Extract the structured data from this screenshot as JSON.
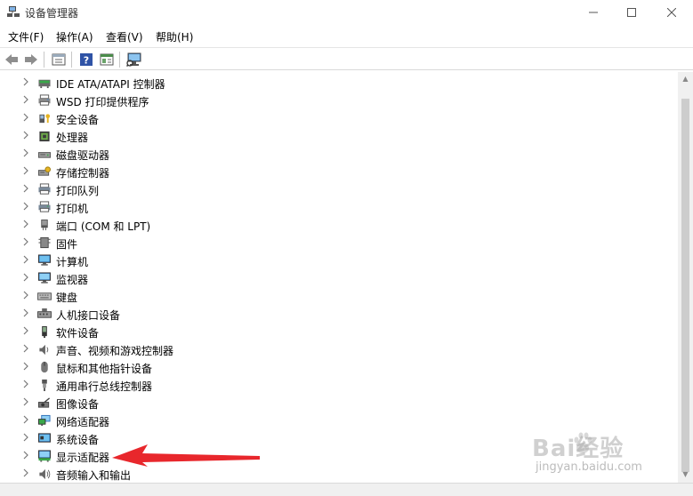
{
  "window": {
    "title": "设备管理器"
  },
  "window_controls": {
    "minimize": "—",
    "maximize": "☐",
    "close": "✕"
  },
  "menu": [
    {
      "label": "文件(F)"
    },
    {
      "label": "操作(A)"
    },
    {
      "label": "查看(V)"
    },
    {
      "label": "帮助(H)"
    }
  ],
  "toolbar": {
    "buttons": [
      "back-icon",
      "forward-icon",
      "properties-icon",
      "help-icon",
      "update-driver-icon",
      "scan-hardware-icon"
    ]
  },
  "tree": {
    "items": [
      {
        "label": "IDE ATA/ATAPI 控制器",
        "icon": "ide-controller-icon"
      },
      {
        "label": "WSD 打印提供程序",
        "icon": "wsd-printer-icon"
      },
      {
        "label": "安全设备",
        "icon": "security-device-icon"
      },
      {
        "label": "处理器",
        "icon": "processor-icon"
      },
      {
        "label": "磁盘驱动器",
        "icon": "disk-drive-icon"
      },
      {
        "label": "存储控制器",
        "icon": "storage-controller-icon"
      },
      {
        "label": "打印队列",
        "icon": "print-queue-icon"
      },
      {
        "label": "打印机",
        "icon": "printer-icon"
      },
      {
        "label": "端口 (COM 和 LPT)",
        "icon": "port-icon"
      },
      {
        "label": "固件",
        "icon": "firmware-icon"
      },
      {
        "label": "计算机",
        "icon": "computer-icon"
      },
      {
        "label": "监视器",
        "icon": "monitor-icon"
      },
      {
        "label": "键盘",
        "icon": "keyboard-icon"
      },
      {
        "label": "人机接口设备",
        "icon": "hid-icon"
      },
      {
        "label": "软件设备",
        "icon": "software-device-icon"
      },
      {
        "label": "声音、视频和游戏控制器",
        "icon": "sound-icon"
      },
      {
        "label": "鼠标和其他指针设备",
        "icon": "mouse-icon"
      },
      {
        "label": "通用串行总线控制器",
        "icon": "usb-icon"
      },
      {
        "label": "图像设备",
        "icon": "imaging-device-icon"
      },
      {
        "label": "网络适配器",
        "icon": "network-adapter-icon"
      },
      {
        "label": "系统设备",
        "icon": "system-device-icon"
      },
      {
        "label": "显示适配器",
        "icon": "display-adapter-icon"
      },
      {
        "label": "音频输入和输出",
        "icon": "audio-io-icon"
      }
    ]
  },
  "annotation": {
    "color": "#e8272c"
  },
  "watermark": {
    "brand": "Bai经验",
    "url": "jingyan.baidu.com"
  }
}
